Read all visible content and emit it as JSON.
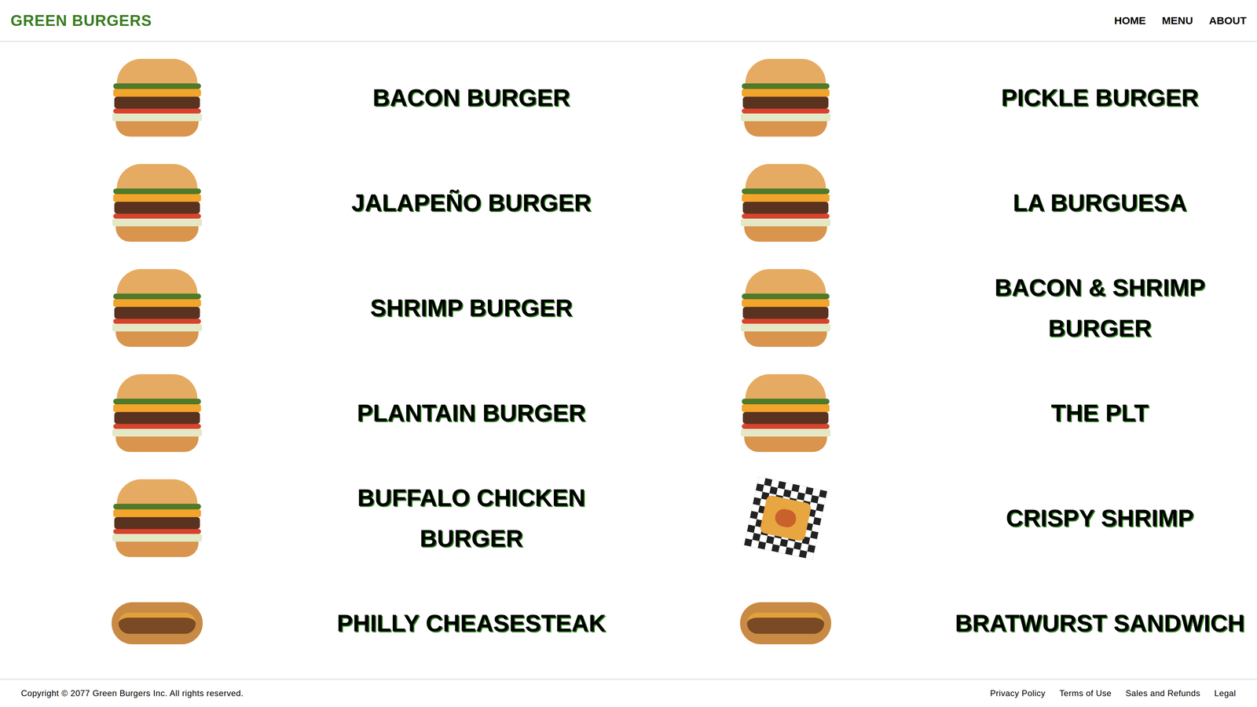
{
  "header": {
    "logo": "GREEN BURGERS",
    "nav": [
      "HOME",
      "MENU",
      "ABOUT"
    ]
  },
  "menu": [
    {
      "name": "BACON BURGER",
      "kind": "burger"
    },
    {
      "name": "PICKLE BURGER",
      "kind": "burger"
    },
    {
      "name": "JALAPEÑO BURGER",
      "kind": "burger"
    },
    {
      "name": "LA BURGUESA",
      "kind": "burger"
    },
    {
      "name": "SHRIMP BURGER",
      "kind": "burger"
    },
    {
      "name": "BACON & SHRIMP BURGER",
      "kind": "burger"
    },
    {
      "name": "PLANTAIN BURGER",
      "kind": "burger"
    },
    {
      "name": "THE PLT",
      "kind": "burger"
    },
    {
      "name": "BUFFALO CHICKEN BURGER",
      "kind": "burger"
    },
    {
      "name": "CRISPY SHRIMP",
      "kind": "basket"
    },
    {
      "name": "PHILLY CHEASESTEAK",
      "kind": "sandwich"
    },
    {
      "name": "BRATWURST SANDWICH",
      "kind": "sandwich"
    }
  ],
  "footer": {
    "copyright": "Copyright © 2077 Green Burgers Inc. All rights reserved.",
    "links": [
      "Privacy Policy",
      "Terms of Use",
      "Sales and Refunds",
      "Legal"
    ]
  }
}
